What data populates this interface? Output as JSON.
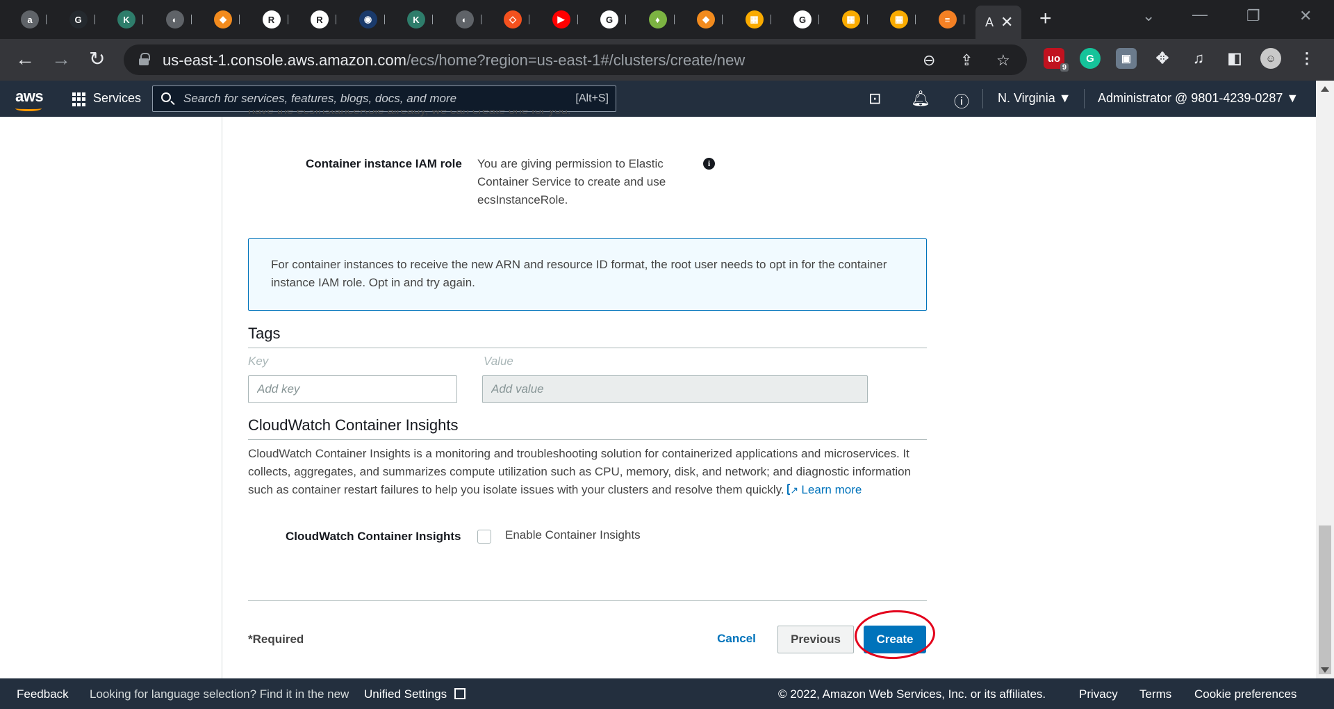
{
  "browser": {
    "tabs": [
      {
        "letter": "a",
        "color": "#5f6368"
      },
      {
        "letter": "G",
        "color": "#24292e"
      },
      {
        "letter": "K",
        "color": "#2e7d6b"
      },
      {
        "letter": "◐",
        "color": "#5f6368"
      },
      {
        "letter": "◆",
        "color": "#f28b1e"
      },
      {
        "letter": "R",
        "color": "#ffffff"
      },
      {
        "letter": "R",
        "color": "#ffffff"
      },
      {
        "letter": "◉",
        "color": "#1a3a6b"
      },
      {
        "letter": "K",
        "color": "#2e7d6b"
      },
      {
        "letter": "◐",
        "color": "#5f6368"
      },
      {
        "letter": "◇",
        "color": "#f4511e"
      },
      {
        "letter": "▶",
        "color": "#ff0000"
      },
      {
        "letter": "G",
        "color": "#ffffff"
      },
      {
        "letter": "♦",
        "color": "#7cb342"
      },
      {
        "letter": "◆",
        "color": "#f28b1e"
      },
      {
        "letter": "▦",
        "color": "#f9ab00"
      },
      {
        "letter": "G",
        "color": "#ffffff"
      },
      {
        "letter": "▦",
        "color": "#f9ab00"
      },
      {
        "letter": "▦",
        "color": "#f9ab00"
      },
      {
        "letter": "≡",
        "color": "#f48024"
      }
    ],
    "active_tab": {
      "label": "A",
      "close": "✕"
    },
    "new_tab": "+",
    "url_host": "us-east-1.console.aws.amazon.com",
    "url_path": "/ecs/home?region=us-east-1#/clusters/create/new",
    "ublock_count": "9"
  },
  "aws_header": {
    "logo": "aws",
    "services": "Services",
    "search_placeholder": "Search for services, features, blogs, docs, and more",
    "search_shortcut": "[Alt+S]",
    "region": "N. Virginia ▼",
    "account": "Administrator @ 9801-4239-0287 ▼"
  },
  "form": {
    "cut_text": "have the ecsInstanceRole already, we can create one for you.",
    "iam_role_label": "Container instance IAM role",
    "iam_role_text": "You are giving permission to Elastic Container Service to create and use ecsInstanceRole.",
    "info_icon": "i",
    "alert_text": "For container instances to receive the new ARN and resource ID format, the root user needs to opt in for the container instance IAM role. Opt in and try again.",
    "tags_title": "Tags",
    "key_label": "Key",
    "value_label": "Value",
    "key_placeholder": "Add key",
    "value_placeholder": "Add value",
    "insights_title": "CloudWatch Container Insights",
    "insights_desc": "CloudWatch Container Insights is a monitoring and troubleshooting solution for containerized applications and microservices. It collects, aggregates, and summarizes compute utilization such as CPU, memory, disk, and network; and diagnostic information such as container restart failures to help you isolate issues with your clusters and resolve them quickly.",
    "learn_more": "Learn more",
    "insights_label": "CloudWatch Container Insights",
    "insights_checkbox_label": "Enable Container Insights",
    "insights_enabled": false,
    "required": "*Required",
    "cancel": "Cancel",
    "previous": "Previous",
    "create": "Create"
  },
  "aws_footer": {
    "feedback": "Feedback",
    "lang_msg": "Looking for language selection? Find it in the new",
    "unified": "Unified Settings",
    "copyright": "© 2022, Amazon Web Services, Inc. or its affiliates.",
    "privacy": "Privacy",
    "terms": "Terms",
    "cookies": "Cookie preferences"
  }
}
